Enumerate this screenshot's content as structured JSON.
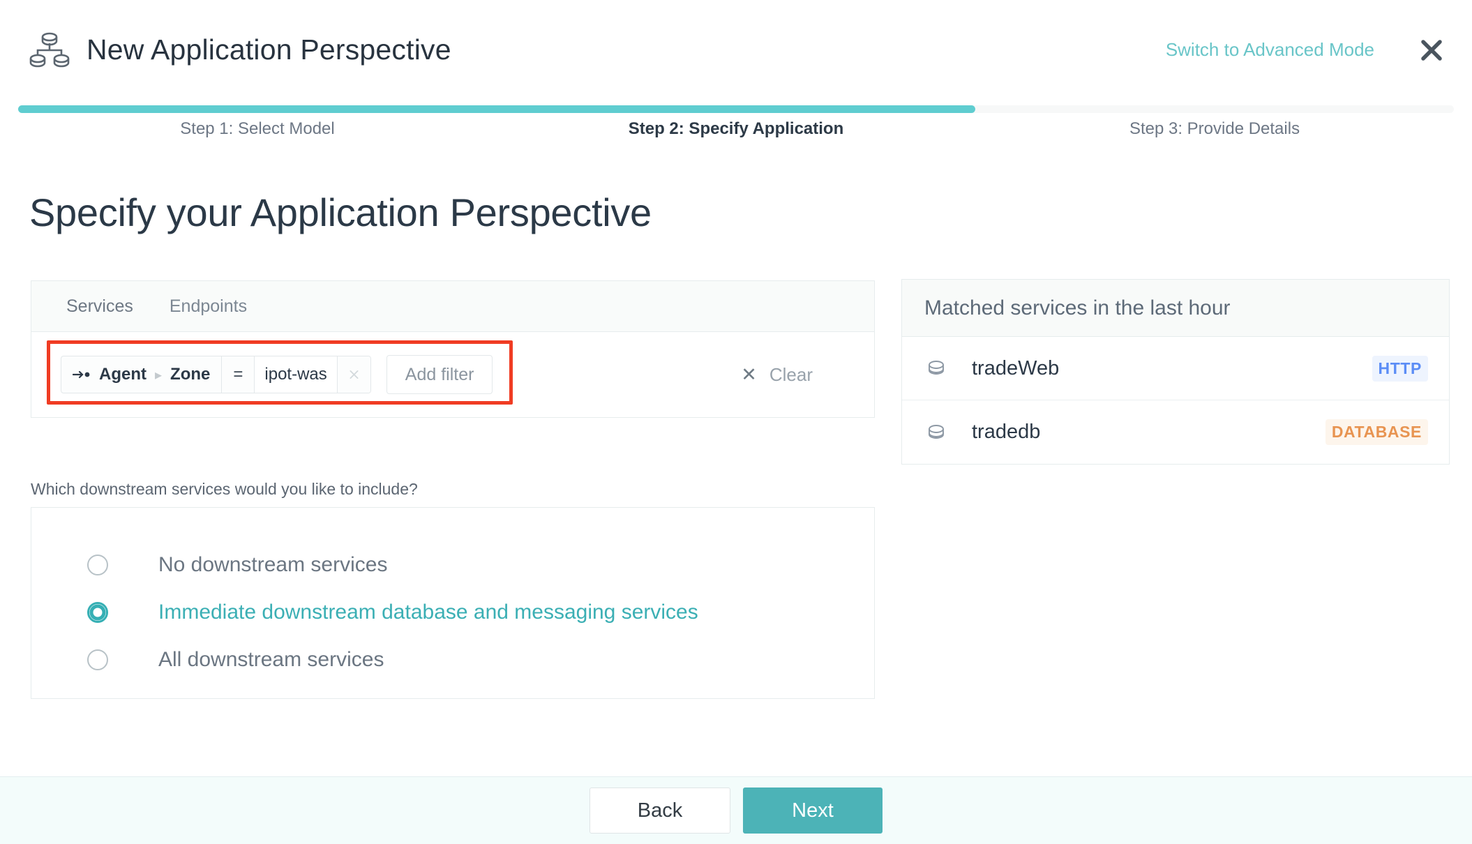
{
  "header": {
    "icon": "topology-icon",
    "title": "New Application Perspective",
    "switch_link": "Switch to Advanced Mode",
    "close_icon": "close-icon"
  },
  "stepper": {
    "progress_percent": 66.7,
    "steps": [
      {
        "label": "Step 1: Select Model",
        "active": false
      },
      {
        "label": "Step 2: Specify Application",
        "active": true
      },
      {
        "label": "Step 3: Provide Details",
        "active": false
      }
    ]
  },
  "page": {
    "title": "Specify your Application Perspective"
  },
  "filter_panel": {
    "tabs": [
      {
        "label": "Services",
        "active": true
      },
      {
        "label": "Endpoints",
        "active": false
      }
    ],
    "chip": {
      "icon": "arrow-to-dot-icon",
      "key_primary": "Agent",
      "key_separator": "▸",
      "key_secondary": "Zone",
      "operator": "=",
      "value": "ipot-was",
      "remove_icon": "close-icon"
    },
    "add_filter_label": "Add filter",
    "clear": {
      "icon": "close-icon",
      "label": "Clear"
    },
    "highlight_color": "#f03c23"
  },
  "downstream": {
    "question": "Which downstream services would you like to include?",
    "options": [
      {
        "label": "No downstream services",
        "selected": false
      },
      {
        "label": "Immediate downstream database and messaging services",
        "selected": true
      },
      {
        "label": "All downstream services",
        "selected": false
      }
    ]
  },
  "matched_panel": {
    "title": "Matched services in the last hour",
    "rows": [
      {
        "icon": "database-icon",
        "name": "tradeWeb",
        "badge": "HTTP",
        "badge_type": "http"
      },
      {
        "icon": "database-icon",
        "name": "tradedb",
        "badge": "DATABASE",
        "badge_type": "database"
      }
    ]
  },
  "footer": {
    "back_label": "Back",
    "next_label": "Next"
  },
  "colors": {
    "accent_teal": "#4cb3b7",
    "progress_teal": "#5fcdd0",
    "link_teal": "#69c5c8",
    "highlight_red": "#f03c23",
    "badge_http": "#5b8df6",
    "badge_database": "#e89451",
    "footer_bg": "#f3fcfb"
  }
}
